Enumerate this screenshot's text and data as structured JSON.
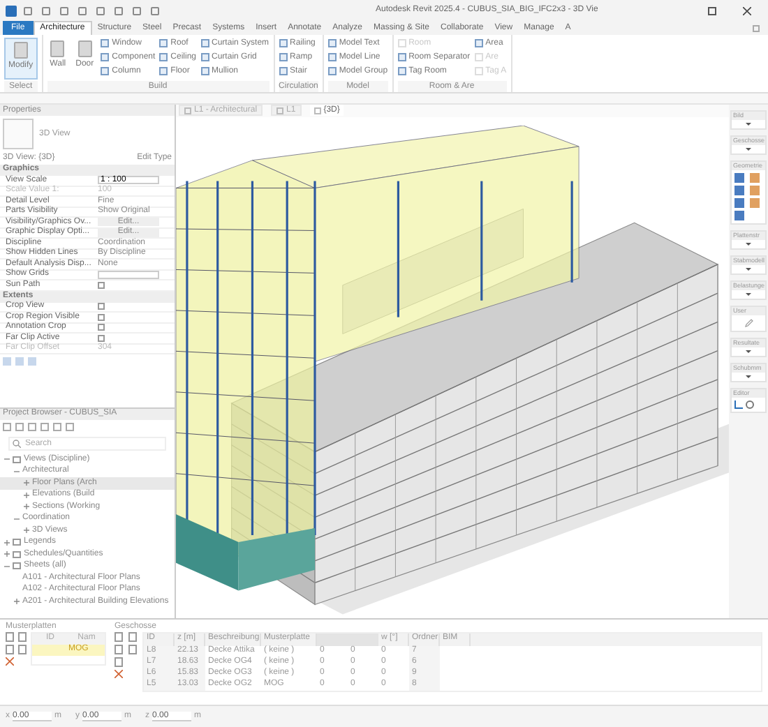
{
  "window": {
    "title": "Autodesk Revit 2025.4 - CUBUS_SIA_BIG_IFC2x3 - 3D Vie"
  },
  "ribbon_tabs": [
    {
      "label": "File",
      "selected": false,
      "kind": "file"
    },
    {
      "label": "Architecture",
      "selected": true,
      "kind": "tab"
    },
    {
      "label": "Structure",
      "selected": false,
      "kind": "tab"
    },
    {
      "label": "Steel",
      "selected": false,
      "kind": "tab"
    },
    {
      "label": "Precast",
      "selected": false,
      "kind": "tab"
    },
    {
      "label": "Systems",
      "selected": false,
      "kind": "tab"
    },
    {
      "label": "Insert",
      "selected": false,
      "kind": "tab"
    },
    {
      "label": "Annotate",
      "selected": false,
      "kind": "tab"
    },
    {
      "label": "Analyze",
      "selected": false,
      "kind": "tab"
    },
    {
      "label": "Massing & Site",
      "selected": false,
      "kind": "tab"
    },
    {
      "label": "Collaborate",
      "selected": false,
      "kind": "tab"
    },
    {
      "label": "View",
      "selected": false,
      "kind": "tab"
    },
    {
      "label": "Manage",
      "selected": false,
      "kind": "tab"
    },
    {
      "label": "A",
      "selected": false,
      "kind": "tab"
    }
  ],
  "ribbon_panels": [
    {
      "title": "Select",
      "tools": [
        {
          "label": "Modify",
          "kind": "large",
          "disabled": false
        }
      ]
    },
    {
      "title": "Build",
      "tools": [
        {
          "label": "Wall",
          "kind": "large",
          "disabled": false
        },
        {
          "label": "Door",
          "kind": "large",
          "disabled": false
        },
        {
          "label": "Window",
          "kind": "small",
          "disabled": false
        },
        {
          "label": "Component",
          "kind": "small",
          "disabled": false
        },
        {
          "label": "Column",
          "kind": "small",
          "disabled": false
        },
        {
          "label": "Roof",
          "kind": "small",
          "disabled": false
        },
        {
          "label": "Ceiling",
          "kind": "small",
          "disabled": false
        },
        {
          "label": "Floor",
          "kind": "small",
          "disabled": false
        },
        {
          "label": "Curtain System",
          "kind": "small",
          "disabled": false
        },
        {
          "label": "Curtain Grid",
          "kind": "small",
          "disabled": false
        },
        {
          "label": "Mullion",
          "kind": "small",
          "disabled": false
        }
      ]
    },
    {
      "title": "Circulation",
      "tools": [
        {
          "label": "Railing",
          "kind": "small",
          "disabled": false
        },
        {
          "label": "Ramp",
          "kind": "small",
          "disabled": false
        },
        {
          "label": "Stair",
          "kind": "small",
          "disabled": false
        }
      ]
    },
    {
      "title": "Model",
      "tools": [
        {
          "label": "Model Text",
          "kind": "small",
          "disabled": false
        },
        {
          "label": "Model Line",
          "kind": "small",
          "disabled": false
        },
        {
          "label": "Model Group",
          "kind": "small",
          "disabled": false
        }
      ]
    },
    {
      "title": "Room & Are",
      "tools": [
        {
          "label": "Room",
          "kind": "small",
          "disabled": true
        },
        {
          "label": "Room Separator",
          "kind": "small",
          "disabled": false
        },
        {
          "label": "Tag Room",
          "kind": "small",
          "disabled": false
        },
        {
          "label": "Area",
          "kind": "small",
          "disabled": false
        },
        {
          "label": "Are",
          "kind": "small",
          "disabled": true
        },
        {
          "label": "Tag A",
          "kind": "small",
          "disabled": true
        }
      ]
    }
  ],
  "properties": {
    "title": "Properties",
    "type_name": "3D View",
    "instance": "3D View: {3D}",
    "edit_type": "Edit Type",
    "sections": [
      {
        "title": "Graphics",
        "rows": [
          {
            "label": "View Scale",
            "value": "1 : 100",
            "kind": "field",
            "disabled": false
          },
          {
            "label": "Scale Value    1:",
            "value": "100",
            "kind": "text",
            "disabled": true
          },
          {
            "label": "Detail Level",
            "value": "Fine",
            "kind": "text",
            "disabled": false
          },
          {
            "label": "Parts Visibility",
            "value": "Show Original",
            "kind": "text",
            "disabled": false
          },
          {
            "label": "Visibility/Graphics Ov...",
            "value": "Edit...",
            "kind": "button",
            "disabled": false
          },
          {
            "label": "Graphic Display Opti...",
            "value": "Edit...",
            "kind": "button",
            "disabled": false
          },
          {
            "label": "Discipline",
            "value": "Coordination",
            "kind": "text",
            "disabled": false
          },
          {
            "label": "Show Hidden Lines",
            "value": "By Discipline",
            "kind": "text",
            "disabled": false
          },
          {
            "label": "Default Analysis Disp...",
            "value": "None",
            "kind": "text",
            "disabled": false
          },
          {
            "label": "Show Grids",
            "kind": "field",
            "disabled": false
          },
          {
            "label": "Sun Path",
            "kind": "checkbox",
            "checked": false,
            "disabled": false
          }
        ]
      },
      {
        "title": "Extents",
        "rows": [
          {
            "label": "Crop View",
            "kind": "checkbox",
            "checked": false,
            "disabled": false
          },
          {
            "label": "Crop Region Visible",
            "kind": "checkbox",
            "checked": false,
            "disabled": false
          },
          {
            "label": "Annotation Crop",
            "kind": "checkbox",
            "checked": false,
            "disabled": false
          },
          {
            "label": "Far Clip Active",
            "kind": "checkbox",
            "checked": false,
            "disabled": false
          },
          {
            "label": "Far Clip Offset",
            "value": "304",
            "kind": "text",
            "disabled": true
          }
        ]
      }
    ]
  },
  "project_browser": {
    "title": "Project Browser - CUBUS_SIA",
    "search": {
      "placeholder": "Search"
    },
    "tree": [
      {
        "label": "Views (Discipline)",
        "kind": "category",
        "expanded": true,
        "selected": false,
        "children": [
          {
            "label": "Architectural",
            "expanded": true,
            "selected": false,
            "children": [
              {
                "label": "Floor Plans (Arch",
                "expanded": false,
                "selected": true
              },
              {
                "label": "Elevations (Build",
                "expanded": false,
                "selected": false
              },
              {
                "label": "Sections (Working",
                "expanded": false,
                "selected": false
              }
            ]
          },
          {
            "label": "Coordination",
            "expanded": true,
            "selected": false,
            "children": [
              {
                "label": "3D Views",
                "expanded": false,
                "selected": false
              }
            ]
          }
        ]
      },
      {
        "label": "Legends",
        "kind": "category",
        "expanded": false,
        "selected": false
      },
      {
        "label": "Schedules/Quantities",
        "kind": "category",
        "expanded": false,
        "selected": false
      },
      {
        "label": "Sheets (all)",
        "kind": "category",
        "expanded": true,
        "selected": false,
        "children": [
          {
            "label": "A101 - Architectural Floor Plans",
            "selected": false
          },
          {
            "label": "A102 - Architectural Floor Plans",
            "selected": false
          },
          {
            "label": "A201 - Architectural Building Elevations",
            "expanded": false,
            "selected": false
          }
        ]
      }
    ]
  },
  "view_tabs": [
    {
      "label": "L1 - Architectural",
      "selected": false
    },
    {
      "label": "L1",
      "selected": false
    },
    {
      "label": "{3D}",
      "selected": true
    }
  ],
  "cubus_toolbar": [
    {
      "title": "Bild",
      "kind": "dropdown"
    },
    {
      "title": "Geschosse",
      "kind": "dropdown"
    },
    {
      "title": "Geometrie",
      "kind": "geometry"
    },
    {
      "title": "Plattenstr",
      "kind": "dropdown"
    },
    {
      "title": "Stabmodell",
      "kind": "dropdown"
    },
    {
      "title": "Belastunge",
      "kind": "dropdown"
    },
    {
      "title": "User",
      "kind": "user"
    },
    {
      "title": "Resultate",
      "kind": "dropdown"
    },
    {
      "title": "Schubmm",
      "kind": "dropdown"
    },
    {
      "title": "Editor",
      "kind": "editor"
    }
  ],
  "musterplatten": {
    "title": "Musterplatten",
    "columns": [
      "ID",
      "Nam"
    ],
    "rows": [
      {
        "name": "MOG",
        "selected": true
      }
    ]
  },
  "geschosse": {
    "title": "Geschosse",
    "columns": [
      {
        "label": "ID"
      },
      {
        "label": "z [m]"
      },
      {
        "label": "Beschreibung"
      },
      {
        "label": "Musterplatte"
      },
      {
        "covered": true
      },
      {
        "covered": true
      },
      {
        "label": "w [°]"
      },
      {
        "label": "Ordner"
      },
      {
        "label": "BIM"
      }
    ],
    "rows": [
      {
        "cells": [
          "L8",
          "22.13",
          "Decke Attika",
          "( keine )",
          "0",
          "0",
          "0",
          "7"
        ]
      },
      {
        "cells": [
          "L7",
          "18.63",
          "Decke OG4",
          "( keine )",
          "0",
          "0",
          "0",
          "6"
        ]
      },
      {
        "cells": [
          "L6",
          "15.83",
          "Decke OG3",
          "( keine )",
          "0",
          "0",
          "0",
          "9"
        ]
      },
      {
        "cells": [
          "L5",
          "13.03",
          "Decke OG2",
          "MOG",
          "0",
          "0",
          "0",
          "8"
        ]
      }
    ]
  },
  "status_bar": {
    "coordinates": [
      {
        "axis": "x",
        "value": "0.00",
        "unit": "m"
      },
      {
        "axis": "y",
        "value": "0.00",
        "unit": "m"
      },
      {
        "axis": "z",
        "value": "0.00",
        "unit": "m"
      }
    ]
  }
}
